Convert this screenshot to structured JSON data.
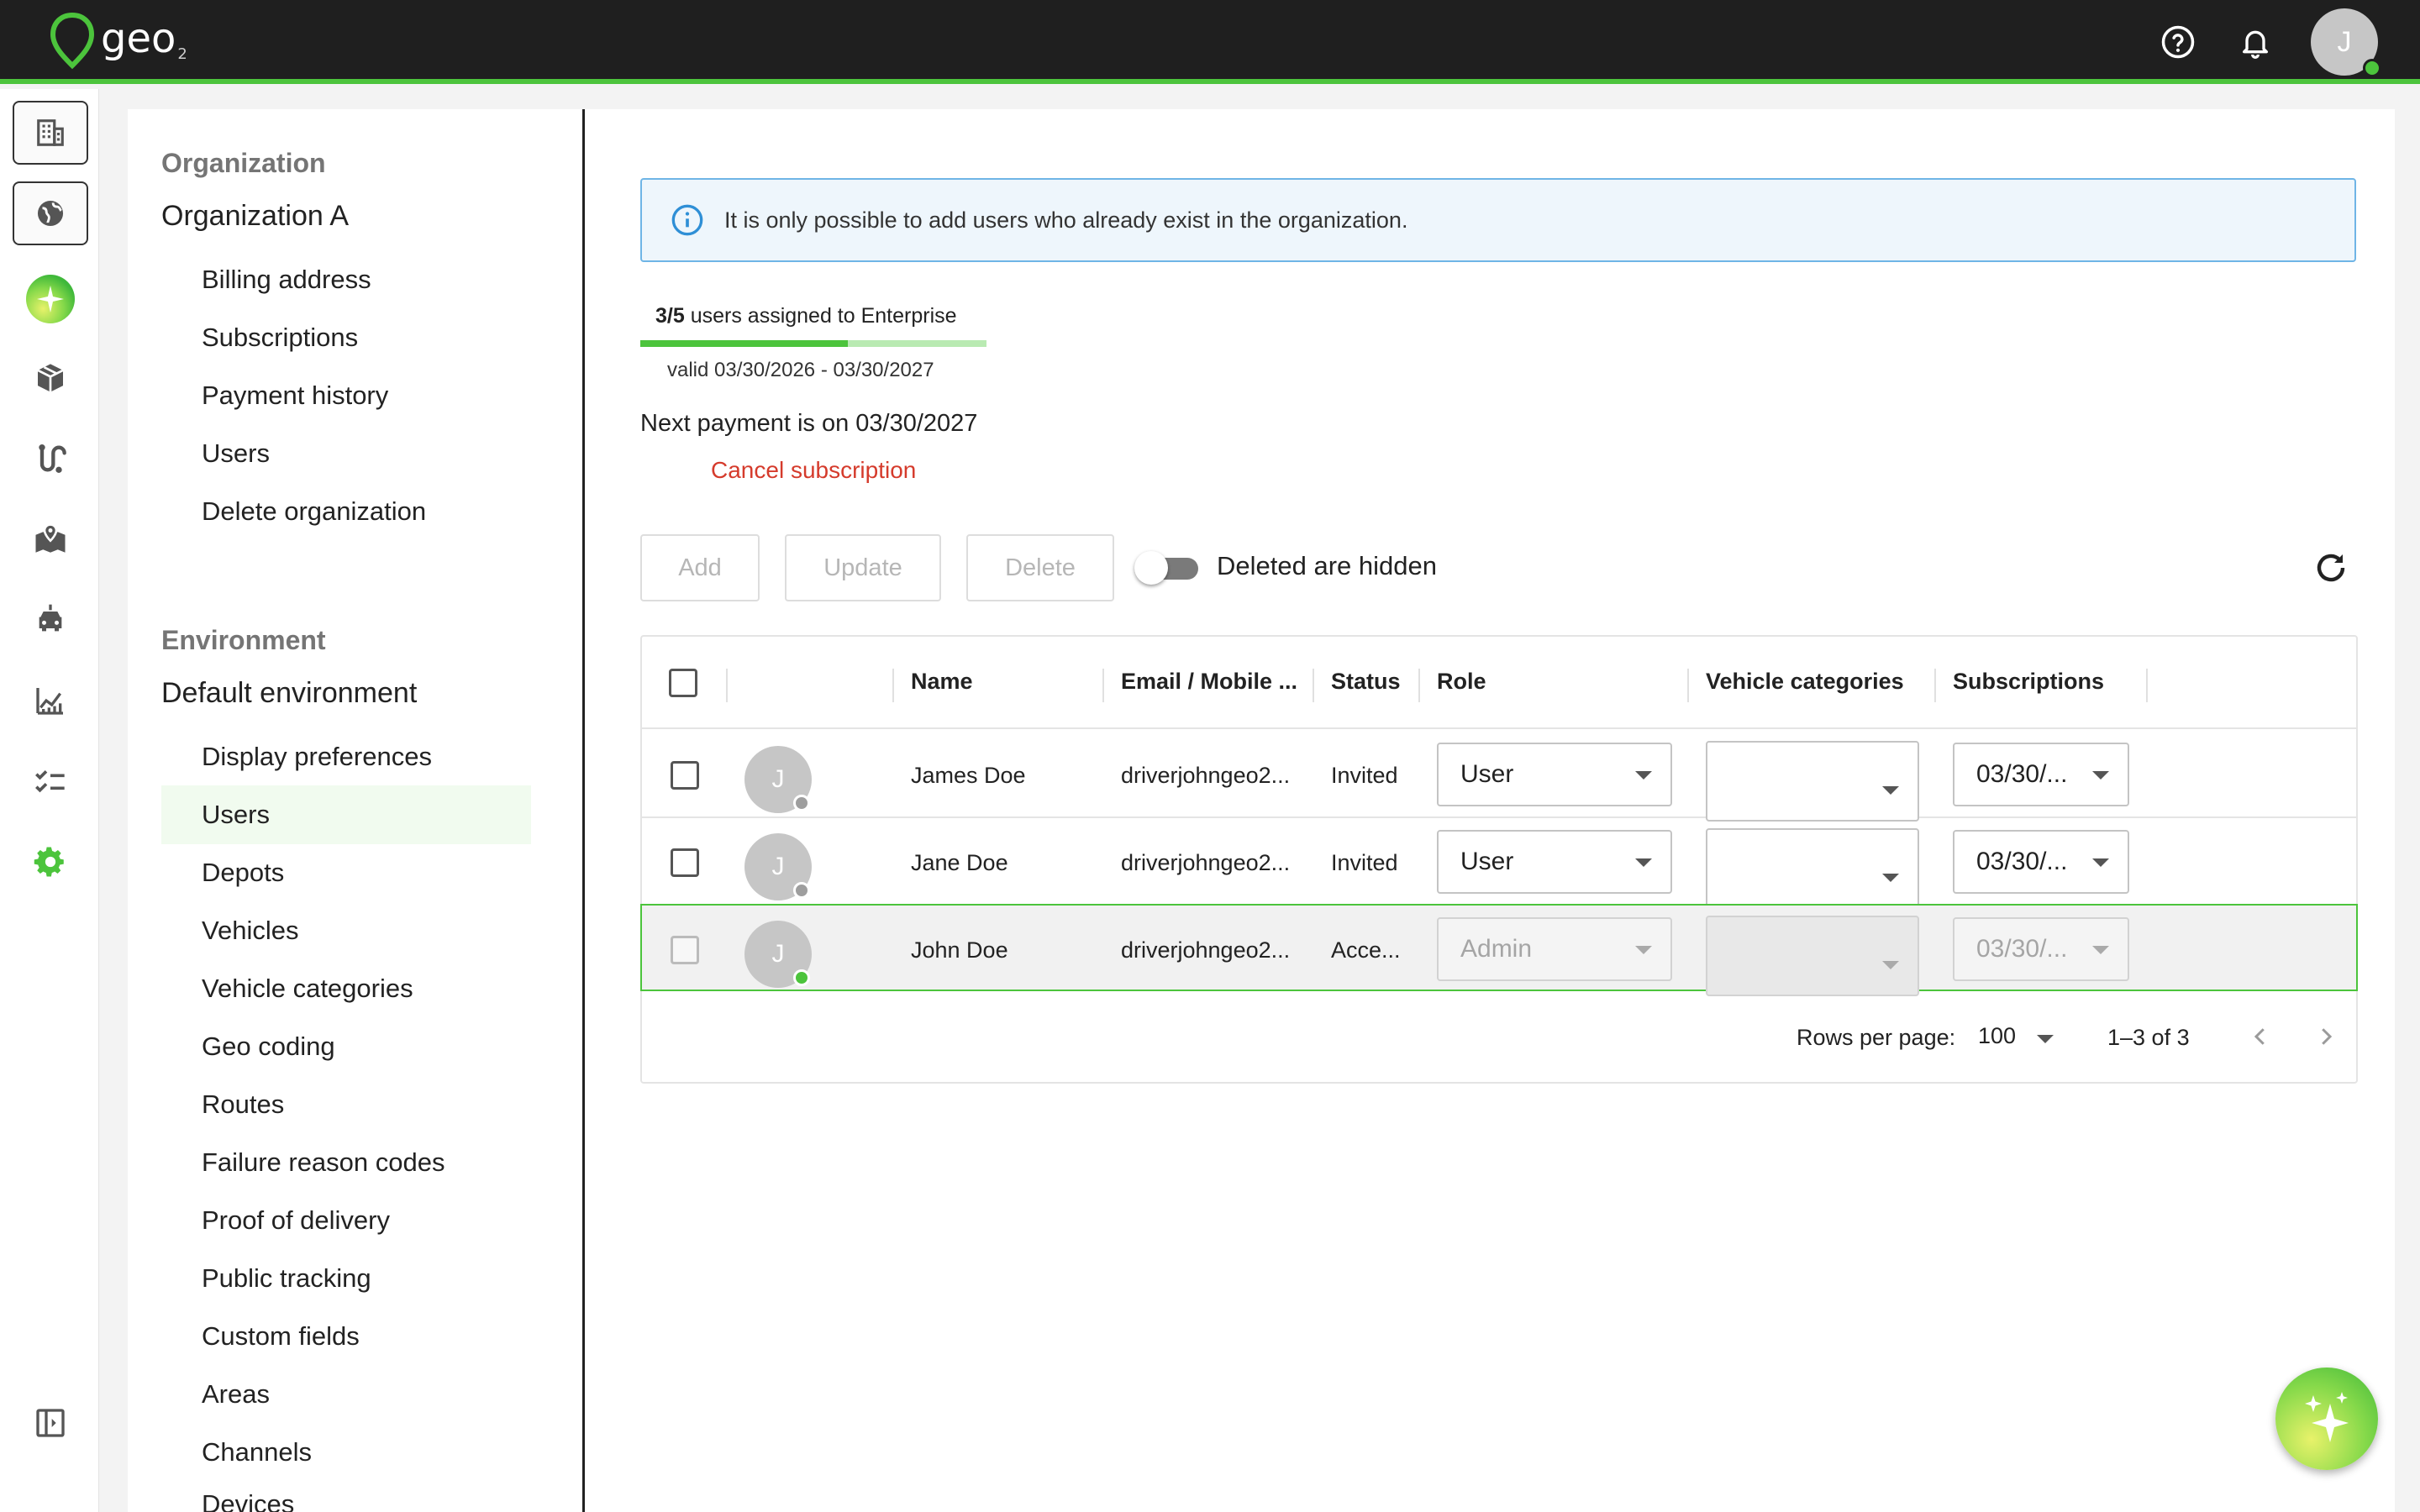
{
  "app": {
    "logo_text": "geo",
    "logo_sub": "2",
    "user_initial": "J",
    "accent": "#4cc43c"
  },
  "topbar_icons": [
    "help-circle-icon",
    "bell-icon"
  ],
  "rail": [
    "building-icon",
    "globe-icon",
    "ai-sparkle-icon",
    "package-icon",
    "route-icon",
    "map-pin-icon",
    "car-icon",
    "analytics-icon",
    "checklist-icon",
    "settings-gear-icon",
    "collapse-panel-icon"
  ],
  "nav": {
    "org_heading": "Organization",
    "org_name": "Organization A",
    "org_items": [
      "Billing address",
      "Subscriptions",
      "Payment history",
      "Users",
      "Delete organization"
    ],
    "env_heading": "Environment",
    "env_name": "Default environment",
    "env_items": [
      "Display preferences",
      "Users",
      "Depots",
      "Vehicles",
      "Vehicle categories",
      "Geo coding",
      "Routes",
      "Failure reason codes",
      "Proof of delivery",
      "Public tracking",
      "Custom fields",
      "Areas",
      "Channels",
      "Devices"
    ]
  },
  "info": {
    "text": "It is only possible to add users who already exist in the organization."
  },
  "subscription": {
    "assigned_count": "3/5",
    "assigned_text": " users assigned to Enterprise",
    "assigned_fraction": 0.6,
    "valid": "valid 03/30/2026 - 03/30/2027",
    "next_payment": "Next payment is on 03/30/2027",
    "cancel": "Cancel subscription"
  },
  "toolbar": {
    "add": "Add",
    "update": "Update",
    "delete": "Delete",
    "toggle_label": "Deleted are hidden"
  },
  "table": {
    "columns": [
      "Name",
      "Email / Mobile ...",
      "Status",
      "Role",
      "Vehicle categories",
      "Subscriptions"
    ],
    "rows": [
      {
        "initial": "J",
        "name": "James Doe",
        "email": "driverjohngeo2...",
        "status": "Invited",
        "role": "User",
        "vehicle_categories": "",
        "subscription": "03/30/...",
        "status_color": "#9e9e9e"
      },
      {
        "initial": "J",
        "name": "Jane Doe",
        "email": "driverjohngeo2...",
        "status": "Invited",
        "role": "User",
        "vehicle_categories": "",
        "subscription": "03/30/...",
        "status_color": "#9e9e9e"
      },
      {
        "initial": "J",
        "name": "John Doe",
        "email": "driverjohngeo2...",
        "status": "Acce...",
        "role": "Admin",
        "vehicle_categories": "",
        "subscription": "03/30/...",
        "status_color": "#4cc43c"
      }
    ],
    "rows_per_page_label": "Rows per page:",
    "rows_per_page": "100",
    "range": "1–3 of 3"
  }
}
